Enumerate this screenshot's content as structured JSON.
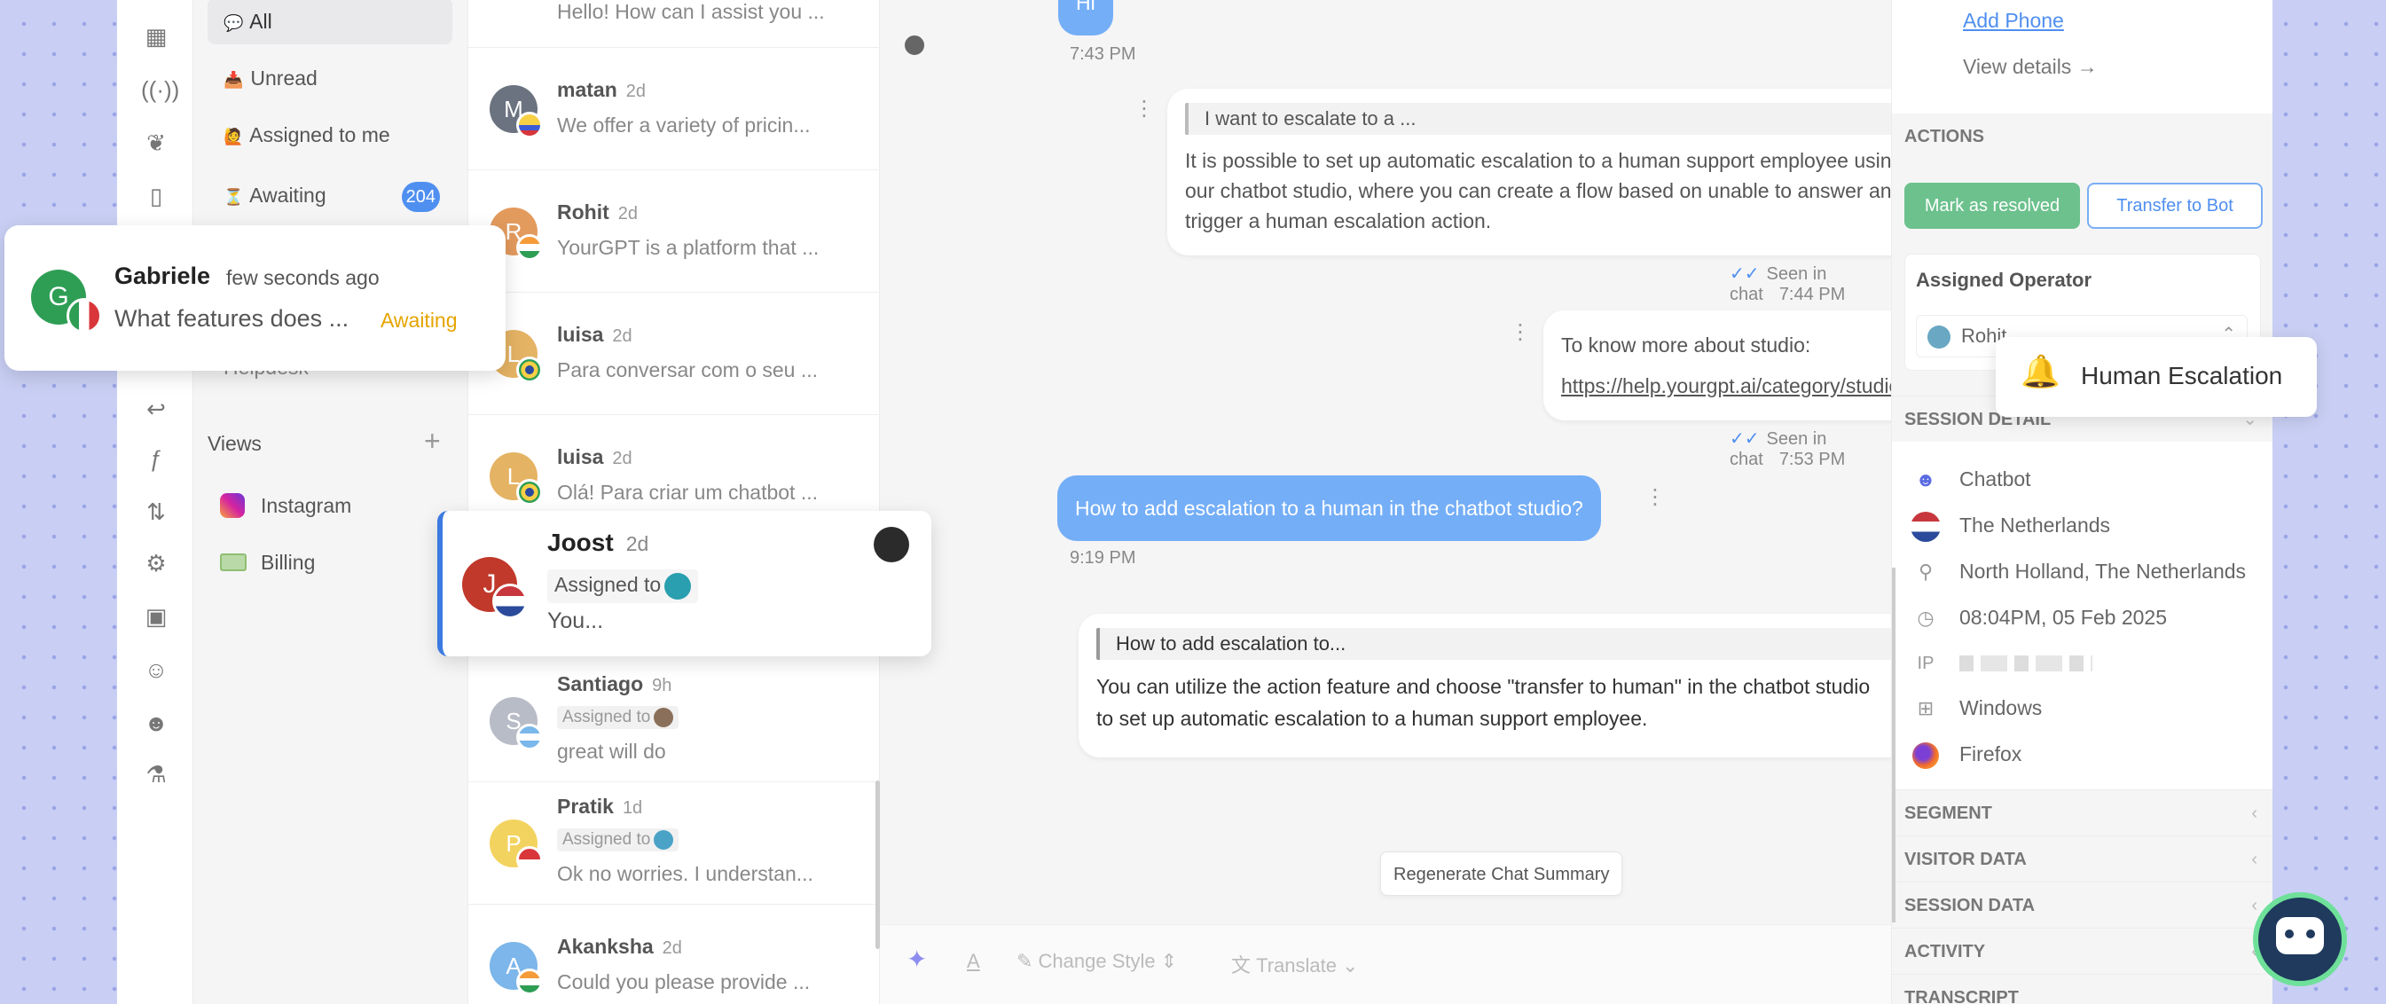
{
  "nav": {
    "items": [
      {
        "label": "All",
        "emoji": "💬"
      },
      {
        "label": "Unread",
        "emoji": "📥"
      },
      {
        "label": "Assigned to me",
        "emoji": "🙋"
      },
      {
        "label": "Awaiting",
        "emoji": "⏳",
        "badge": "204"
      }
    ],
    "helpdesk_label": "Helpdesk",
    "views_title": "Views",
    "views_add": "+",
    "views": [
      {
        "label": "Instagram"
      },
      {
        "label": "Billing"
      }
    ]
  },
  "conversations": [
    {
      "preview_top": "Hello! How can I assist you ..."
    },
    {
      "name": "matan",
      "time": "2d",
      "initial": "M",
      "preview": "We offer a variety of pricin...",
      "color": "#6b7280"
    },
    {
      "name": "Rohit",
      "time": "2d",
      "initial": "R",
      "preview": "YourGPT is a platform that ...",
      "color": "#e39a5d"
    },
    {
      "name": "luisa",
      "time": "2d",
      "initial": "L",
      "preview": "Para conversar com o seu ...",
      "color": "#e5b364"
    },
    {
      "name": "luisa",
      "time": "2d",
      "initial": "L",
      "preview": "Olá! Para criar um chatbot ...",
      "color": "#e5b364"
    },
    {
      "name": "Santiago",
      "time": "9h",
      "initial": "S",
      "assigned": "Assigned to",
      "preview": "great will do",
      "color": "#b8bcc6"
    },
    {
      "name": "Pratik",
      "time": "1d",
      "initial": "P",
      "assigned": "Assigned to",
      "preview": "Ok no worries. I understan...",
      "color": "#f3d35f"
    },
    {
      "name": "Akanksha",
      "time": "2d",
      "initial": "A",
      "preview": "Could you please provide ...",
      "color": "#7cb6ea"
    }
  ],
  "toast": {
    "initial": "G",
    "name": "Gabriele",
    "time": "few seconds ago",
    "preview": "What features does ...",
    "status": "Awaiting",
    "avatar_color": "#2e9e55",
    "status_color": "#e5a400"
  },
  "joost": {
    "initial": "J",
    "name": "Joost",
    "time": "2d",
    "assigned": "Assigned to",
    "preview": "You...",
    "avatar_color": "#c0392b"
  },
  "chat": {
    "top_time": "7:43 PM",
    "top_bubble": "Hi",
    "msg1": {
      "quote": "I want to escalate to a ...",
      "text": "It is possible to set up automatic escalation to a human support employee using our chatbot studio, where you can create a flow based on unable to answer and trigger a human escalation action.",
      "seen": "Seen in chat",
      "time": "7:44 PM"
    },
    "msg2": {
      "text": "To know more about studio:",
      "link": "https://help.yourgpt.ai/category/studio",
      "seen": "Seen in chat",
      "time": "7:53 PM"
    },
    "user_msg": {
      "text": "How to add escalation to a human in the chatbot studio?",
      "time": "9:19 PM"
    },
    "msg3": {
      "quote": "How to add escalation to...",
      "text": "You can utilize the action feature and choose \"transfer to human\" in the chatbot studio to set up automatic escalation to a human support employee."
    },
    "regen": "Regenerate Chat Summary"
  },
  "composer": {
    "change_style": "Change Style",
    "translate": "Translate"
  },
  "panel": {
    "add_phone": "Add Phone",
    "view_details": "View details →",
    "actions_title": "ACTIONS",
    "resolve": "Mark as resolved",
    "transfer": "Transfer to Bot",
    "assigned_operator": "Assigned Operator",
    "operator": "Rohit",
    "session_detail": "SESSION DETAIL",
    "details": [
      {
        "icon": "bot-icon",
        "label": "Chatbot"
      },
      {
        "icon": "flag-icon",
        "label": "The Netherlands"
      },
      {
        "icon": "location-pin-icon",
        "label": "North Holland, The Netherlands"
      },
      {
        "icon": "clock-icon",
        "label": "08:04PM, 05 Feb 2025"
      },
      {
        "icon": "ip-icon",
        "label": "IP"
      },
      {
        "icon": "windows-icon",
        "label": "Windows"
      },
      {
        "icon": "firefox-icon",
        "label": "Firefox"
      }
    ],
    "sections": [
      "SEGMENT",
      "VISITOR DATA",
      "SESSION DATA",
      "ACTIVITY",
      "TRANSCRIPT"
    ]
  },
  "escalation": {
    "label": "Human Escalation"
  },
  "colors": {
    "accent": "#4f8ff0",
    "user_bubble": "#74aef7",
    "resolve": "#6cc18d"
  }
}
